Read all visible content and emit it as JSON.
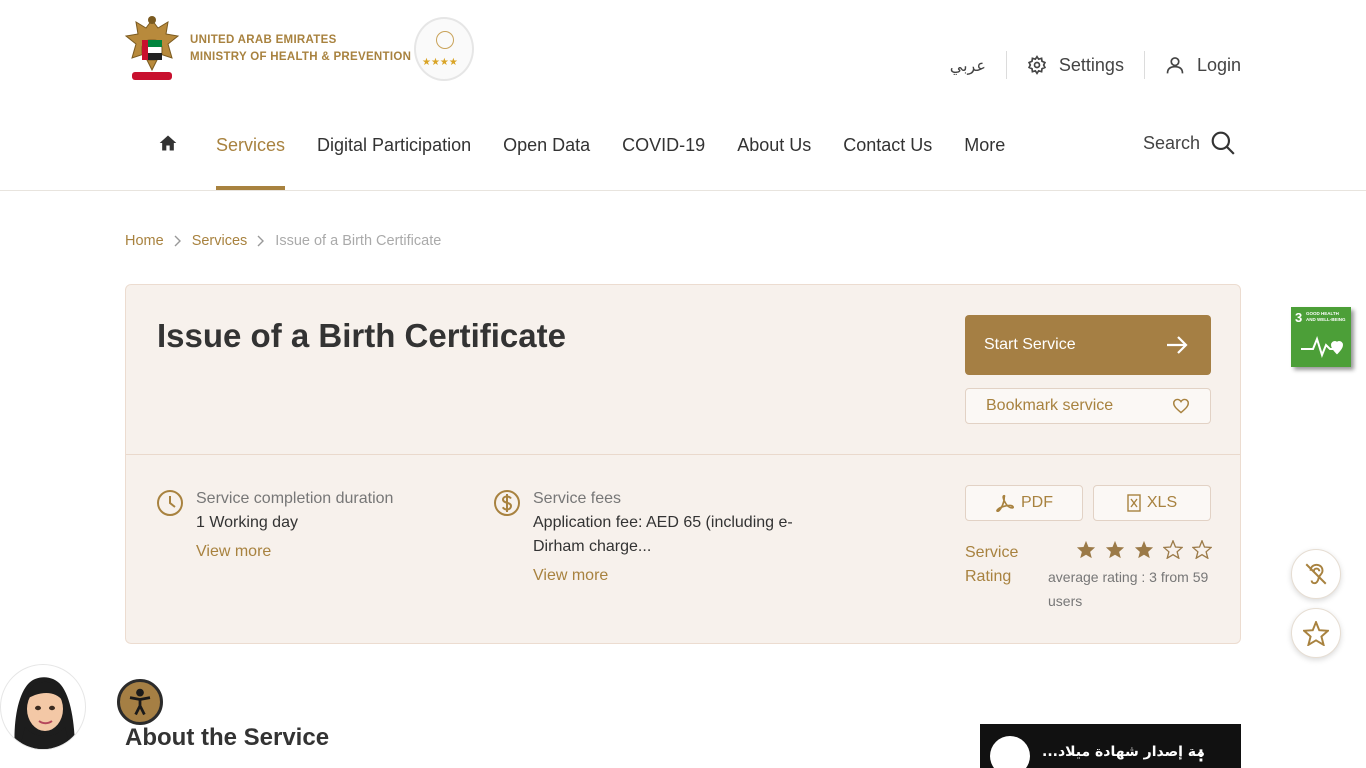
{
  "header": {
    "ministry_line1": "UNITED ARAB EMIRATES",
    "ministry_line2": "MINISTRY OF HEALTH & PREVENTION",
    "stars_badge": "★★★★",
    "language": "عربي",
    "settings_label": "Settings",
    "login_label": "Login",
    "search_label": "Search"
  },
  "nav": {
    "items": [
      {
        "label": "Services",
        "active": true
      },
      {
        "label": "Digital Participation"
      },
      {
        "label": "Open Data"
      },
      {
        "label": "COVID-19"
      },
      {
        "label": "About Us"
      },
      {
        "label": "Contact Us"
      },
      {
        "label": "More"
      }
    ]
  },
  "breadcrumb": [
    "Home",
    "Services",
    "Issue of a Birth Certificate"
  ],
  "service": {
    "title": "Issue of a Birth Certificate",
    "start_label": "Start Service",
    "bookmark_label": "Bookmark service",
    "duration_label": "Service completion duration",
    "duration_value": "1 Working day",
    "fees_label": "Service fees",
    "fees_value_line1": "Application fee: AED 65 (including e-",
    "fees_value_line2": "Dirham charge...",
    "view_more": "View more",
    "pdf_label": "PDF",
    "xls_label": "XLS",
    "rating_label_1": "Service",
    "rating_label_2": "Rating",
    "rating_value": 3,
    "rating_max": 5,
    "rating_text_1": "average rating : 3 from 59",
    "rating_text_2": "users"
  },
  "sdg": {
    "number": "3",
    "text_1": "GOOD HEALTH",
    "text_2": "AND WELL-BEING"
  },
  "about": {
    "title": "About the Service"
  },
  "video": {
    "title": "...مة إصدار شهادة ميلاد"
  },
  "colors": {
    "accent": "#a8823f",
    "button": "#a57f44",
    "card_bg": "#f7f1ec",
    "sdg_green": "#4c9f38"
  }
}
